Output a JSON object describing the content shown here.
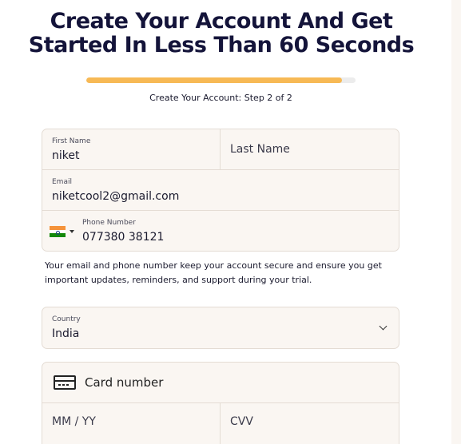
{
  "heading": {
    "line1": "Create Your Account And Get",
    "line2": "Started In Less Than 60 Seconds"
  },
  "progress": {
    "fraction": 0.95,
    "step_label": "Create Your Account: Step 2 of 2"
  },
  "form": {
    "first_name": {
      "label": "First Name",
      "value": "niket"
    },
    "last_name": {
      "placeholder": "Last Name"
    },
    "email": {
      "label": "Email",
      "value": "niketcool2@gmail.com"
    },
    "phone": {
      "label": "Phone Number",
      "value": "077380 38121",
      "country_flag": "india-flag-icon"
    },
    "helper_text": "Your email and phone number keep your account secure and ensure you get important updates, reminders, and support during your trial.",
    "country": {
      "label": "Country",
      "value": "India"
    },
    "card": {
      "number_placeholder": "Card number",
      "expiry_placeholder": "MM / YY",
      "cvv_placeholder": "CVV"
    }
  },
  "colors": {
    "progress_fill": "#f7b955",
    "field_background": "#faf6f2",
    "heading": "#14143a"
  }
}
